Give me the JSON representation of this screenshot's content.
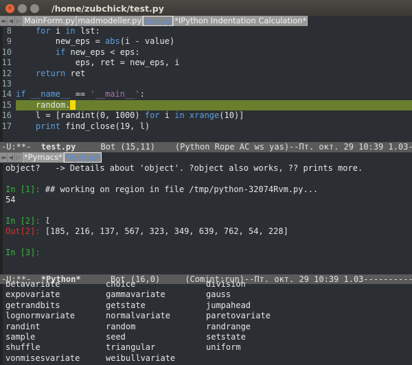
{
  "window": {
    "title": "/home/zubchick/test.py"
  },
  "tabs_top": [
    "MainForm.py",
    "madmodeller.py",
    "test.py",
    "*IPython Indentation Calculation*"
  ],
  "tabs_bottom": [
    "*Pymacs*",
    "*Python*"
  ],
  "editor": {
    "lines": [
      {
        "n": "8",
        "t": [
          [
            "    ",
            ""
          ],
          [
            "for",
            "kw"
          ],
          [
            " i ",
            ""
          ],
          [
            "in",
            "kw"
          ],
          [
            " lst:",
            ""
          ]
        ]
      },
      {
        "n": "9",
        "t": [
          [
            "        new_eps = ",
            ""
          ],
          [
            "abs",
            "bi"
          ],
          [
            "(i - value)",
            ""
          ]
        ]
      },
      {
        "n": "10",
        "t": [
          [
            "        ",
            ""
          ],
          [
            "if",
            "kw"
          ],
          [
            " new_eps < eps:",
            ""
          ]
        ]
      },
      {
        "n": "11",
        "t": [
          [
            "            eps, ret = new_eps, i",
            ""
          ]
        ]
      },
      {
        "n": "12",
        "t": [
          [
            "    ",
            ""
          ],
          [
            "return",
            "kw"
          ],
          [
            " ret",
            ""
          ]
        ]
      },
      {
        "n": "13",
        "t": [
          [
            "",
            ""
          ]
        ]
      },
      {
        "n": "14",
        "t": [
          [
            "if",
            "kw"
          ],
          [
            " ",
            ""
          ],
          [
            "__name__",
            "bi"
          ],
          [
            " == ",
            ""
          ],
          [
            "'__main__'",
            "str"
          ],
          [
            ":",
            ""
          ]
        ]
      },
      {
        "n": "15",
        "t": [
          [
            "    random.",
            ""
          ]
        ],
        "current": true
      },
      {
        "n": "16",
        "t": [
          [
            "    l = [randint(0, 1000) ",
            ""
          ],
          [
            "for",
            "kw"
          ],
          [
            " i ",
            ""
          ],
          [
            "in",
            "kw"
          ],
          [
            " ",
            ""
          ],
          [
            "xrange",
            "bi"
          ],
          [
            "(10)]",
            ""
          ]
        ]
      },
      {
        "n": "17",
        "t": [
          [
            "    ",
            ""
          ],
          [
            "print",
            "kw"
          ],
          [
            " find_close(19, l)",
            ""
          ]
        ]
      }
    ]
  },
  "modeline1": {
    "state": "-U:**-  ",
    "buffer": "test.py",
    "pos": "     Bot (15,11)    ",
    "modes": "(Python Rope AC ws yas)--Пт. окт. 29 10:39 1.03--------"
  },
  "repl": {
    "help": "object?   -> Details about 'object'. ?object also works, ?? prints more.",
    "in1_prompt": "In [1]: ",
    "in1": "## working on region in file /tmp/python-32074Rvm.py...",
    "out1": "54",
    "in2_prompt": "In [2]: ",
    "in2": "l",
    "out2_prompt": "Out[2]: ",
    "out2": "[185, 216, 137, 567, 323, 349, 639, 762, 54, 228]",
    "in3_prompt": "In [3]: "
  },
  "modeline2": {
    "state": "-U:**-  ",
    "buffer": "*Python*",
    "pos": "      Bot (16,0)     ",
    "modes": "(Comint:run)--Пт. окт. 29 10:39 1.03--------------"
  },
  "completions": [
    [
      "betavariate",
      "choice",
      "division"
    ],
    [
      "expovariate",
      "gammavariate",
      "gauss"
    ],
    [
      "getrandbits",
      "getstate",
      "jumpahead"
    ],
    [
      "lognormvariate",
      "normalvariate",
      "paretovariate"
    ],
    [
      "randint",
      "random",
      "randrange"
    ],
    [
      "sample",
      "seed",
      "setstate"
    ],
    [
      "shuffle",
      "triangular",
      "uniform"
    ],
    [
      "vonmisesvariate",
      "weibullvariate",
      ""
    ]
  ]
}
